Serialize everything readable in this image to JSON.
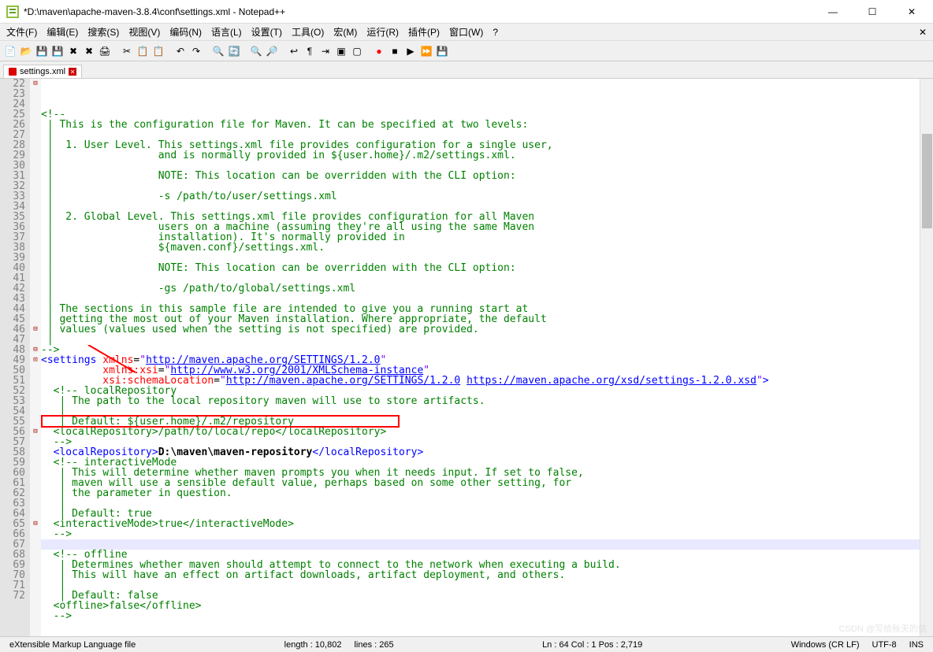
{
  "window": {
    "title": "*D:\\maven\\apache-maven-3.8.4\\conf\\settings.xml - Notepad++",
    "minimize": "—",
    "maximize": "☐",
    "close": "✕"
  },
  "menu": {
    "file": "文件(F)",
    "edit": "编辑(E)",
    "search": "搜索(S)",
    "view": "视图(V)",
    "encoding": "编码(N)",
    "language": "语言(L)",
    "settings": "设置(T)",
    "tools": "工具(O)",
    "macro": "宏(M)",
    "run": "运行(R)",
    "plugins": "插件(P)",
    "window": "窗口(W)",
    "help": "?"
  },
  "tab": {
    "name": "settings.xml"
  },
  "lines": {
    "start": 22,
    "l22": "<!--",
    "l23": " | This is the configuration file for Maven. It can be specified at two levels:",
    "l24": " |",
    "l25": " |  1. User Level. This settings.xml file provides configuration for a single user,",
    "l26": " |                 and is normally provided in ${user.home}/.m2/settings.xml.",
    "l27": " |",
    "l28": " |                 NOTE: This location can be overridden with the CLI option:",
    "l29": " |",
    "l30": " |                 -s /path/to/user/settings.xml",
    "l31": " |",
    "l32": " |  2. Global Level. This settings.xml file provides configuration for all Maven",
    "l33": " |                 users on a machine (assuming they're all using the same Maven",
    "l34": " |                 installation). It's normally provided in",
    "l35": " |                 ${maven.conf}/settings.xml.",
    "l36": " |",
    "l37": " |                 NOTE: This location can be overridden with the CLI option:",
    "l38": " |",
    "l39": " |                 -gs /path/to/global/settings.xml",
    "l40": " |",
    "l41": " | The sections in this sample file are intended to give you a running start at",
    "l42": " | getting the most out of your Maven installation. Where appropriate, the default",
    "l43": " | values (values used when the setting is not specified) are provided.",
    "l44": " |",
    "l45": "-->",
    "l46_tag": "settings",
    "l46_attr": "xmlns",
    "l46_url": "http://maven.apache.org/SETTINGS/1.2.0",
    "l47_attr": "xmlns:xsi",
    "l47_url": "http://www.w3.org/2001/XMLSchema-instance",
    "l48_attr": "xsi:schemaLocation",
    "l48_url1": "http://maven.apache.org/SETTINGS/1.2.0",
    "l48_url2": "https://maven.apache.org/xsd/settings-1.2.0.xsd",
    "l49": "  <!-- localRepository",
    "l50": "   | The path to the local repository maven will use to store artifacts.",
    "l51": "   |",
    "l52": "   | Default: ${user.home}/.m2/repository",
    "l53": "  <localRepository>/path/to/local/repo</localRepository>",
    "l54": "  -->",
    "l55_tag": "localRepository",
    "l55_val": "D:\\maven\\maven-repository",
    "l56": "  <!-- interactiveMode",
    "l57": "   | This will determine whether maven prompts you when it needs input. If set to false,",
    "l58": "   | maven will use a sensible default value, perhaps based on some other setting, for",
    "l59": "   | the parameter in question.",
    "l60": "   |",
    "l61": "   | Default: true",
    "l62": "  <interactiveMode>true</interactiveMode>",
    "l63": "  -->",
    "l65": "  <!-- offline",
    "l66": "   | Determines whether maven should attempt to connect to the network when executing a build.",
    "l67": "   | This will have an effect on artifact downloads, artifact deployment, and others.",
    "l68": "   |",
    "l69": "   | Default: false",
    "l70": "  <offline>false</offline>",
    "l71": "  -->"
  },
  "status": {
    "type": "eXtensible Markup Language file",
    "length": "length : 10,802",
    "linecount": "lines : 265",
    "pos": "Ln : 64   Col : 1   Pos : 2,719",
    "eol": "Windows (CR LF)",
    "enc": "UTF-8",
    "ins": "INS"
  },
  "watermark": "CSDN @写给秋天的信"
}
